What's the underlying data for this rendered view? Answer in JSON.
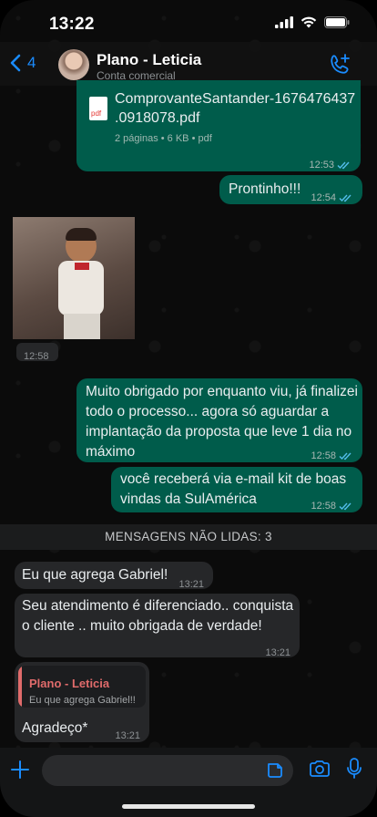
{
  "status_bar": {
    "time": "13:22"
  },
  "header": {
    "back_count": "4",
    "contact_name": "Plano - Leticia",
    "contact_sub": "Conta comercial"
  },
  "messages": {
    "doc": {
      "filename": ".0918078.pdf",
      "filename_line1": "ComprovanteSantander-1676476437",
      "file_badge": "pdf",
      "info": "2 páginas • 6 KB • pdf",
      "time": "12:53"
    },
    "m1": {
      "text": "Prontinho!!!",
      "time": "12:54"
    },
    "gif": {
      "time": "12:58"
    },
    "m2": {
      "text": "Muito obrigado por enquanto viu, já finalizei todo o processo... agora só aguardar a implantação da proposta que leve 1 dia no máximo",
      "time": "12:58"
    },
    "m3": {
      "text": "você receberá via e-mail kit de boas vindas da SulAmérica",
      "time": "12:58"
    },
    "unread_divider": "MENSAGENS NÃO LIDAS: 3",
    "r1": {
      "text": "Eu que agrega Gabriel!",
      "time": "13:21"
    },
    "r2": {
      "text": "Seu atendimento é diferenciado.. conquista o cliente .. muito obrigada de verdade!",
      "time": "13:21"
    },
    "r3": {
      "quote_author": "Plano - Leticia",
      "quote_text": "Eu que agrega Gabriel!!",
      "text": "Agradeço*",
      "time": "13:21"
    }
  },
  "colors": {
    "accent": "#1a8cff",
    "outgoing": "#005c4b",
    "incoming": "#262729",
    "read_ticks": "#53bdeb"
  },
  "icons": [
    "signal-icon",
    "wifi-icon",
    "battery-icon",
    "back-chevron-icon",
    "add-call-icon",
    "pdf-icon",
    "read-ticks-icon",
    "plus-icon",
    "sticker-icon",
    "camera-icon",
    "microphone-icon"
  ]
}
